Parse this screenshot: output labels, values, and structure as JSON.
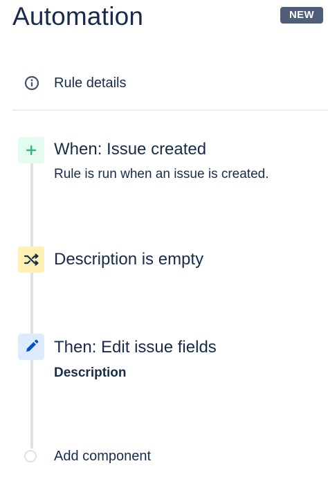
{
  "header": {
    "title": "Automation",
    "badge": "NEW"
  },
  "rule_details": {
    "label": "Rule details",
    "icon": "info-icon"
  },
  "steps": [
    {
      "kind": "trigger",
      "icon": "plus-icon",
      "icon_color": "#36b37e",
      "icon_bg": "#e3fcef",
      "title": "When: Issue created",
      "description": "Rule is run when an issue is created."
    },
    {
      "kind": "condition",
      "icon": "shuffle-icon",
      "icon_color": "#172b4d",
      "icon_bg": "#fff0b3",
      "title": "Description is empty"
    },
    {
      "kind": "action",
      "icon": "pencil-icon",
      "icon_color": "#0052cc",
      "icon_bg": "#deebff",
      "title": "Then: Edit issue fields",
      "description": "Description"
    }
  ],
  "add_component": {
    "label": "Add component"
  },
  "colors": {
    "text": "#172b4d",
    "badge_bg": "#505f79",
    "timeline": "#dfe1e6"
  }
}
